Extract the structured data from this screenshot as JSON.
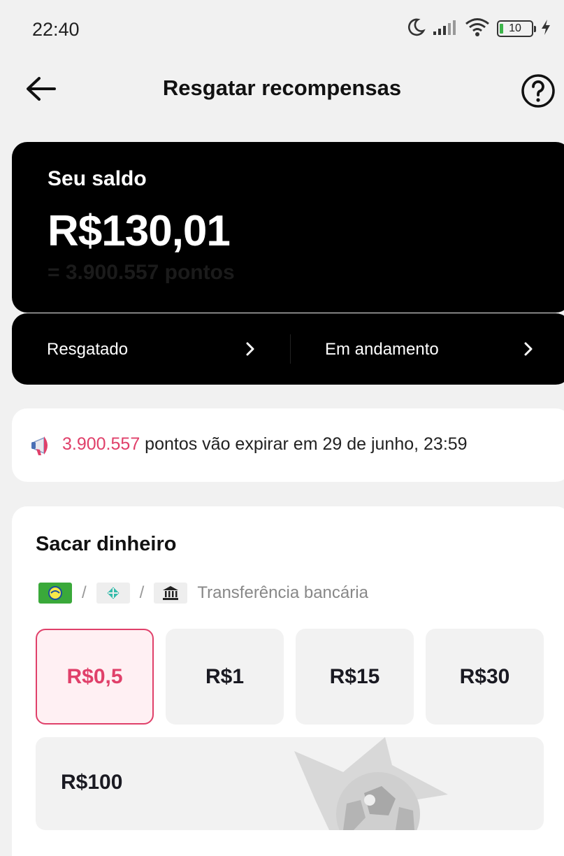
{
  "status_bar": {
    "time": "22:40",
    "battery": "10",
    "icons": [
      "moon-icon",
      "signal-icon",
      "wifi-icon",
      "battery-icon",
      "charging-icon"
    ]
  },
  "header": {
    "title": "Resgatar recompensas",
    "back_icon": "arrow-left-icon",
    "help_icon": "question-circle-icon"
  },
  "balance": {
    "label": "Seu saldo",
    "amount": "R$130,01",
    "points": "= 3.900.557 pontos"
  },
  "history": {
    "redeemed_label": "Resgatado",
    "in_progress_label": "Em andamento"
  },
  "expiry": {
    "points": "3.900.557",
    "text": " pontos vão expirar em 29 de junho, 23:59",
    "icon": "megaphone-icon",
    "accent_color": "#e0406a"
  },
  "cash": {
    "title": "Sacar dinheiro",
    "separator": "/",
    "bank_transfer_label": "Transferência bancária",
    "amounts": [
      "R$0,5",
      "R$1",
      "R$15",
      "R$30"
    ],
    "selected_amount": "R$0,5",
    "big_amount": "R$100"
  }
}
